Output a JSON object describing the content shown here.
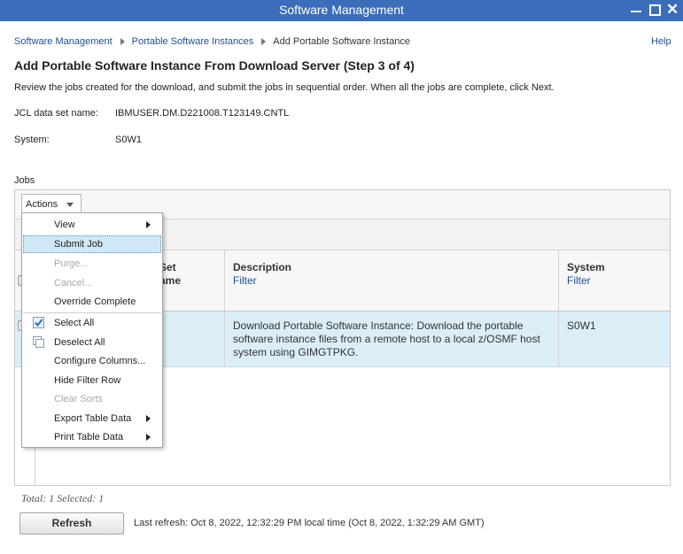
{
  "window": {
    "title": "Software Management"
  },
  "breadcrumb": {
    "items": [
      "Software Management",
      "Portable Software Instances"
    ],
    "current": "Add Portable Software Instance"
  },
  "help_label": "Help",
  "page_title": "Add Portable Software Instance From Download Server (Step 3 of 4)",
  "intro_text": "Review the jobs created for the download, and submit the jobs in sequential order. When all the jobs are complete, click Next.",
  "fields": {
    "jcl": {
      "label": "JCL data set name:",
      "value": "IBMUSER.DM.D221008.T123149.CNTL"
    },
    "system": {
      "label": "System:",
      "value": "S0W1"
    }
  },
  "jobs": {
    "section_label": "Jobs",
    "actions_label": "Actions",
    "columns": {
      "data_set_name_partial": [
        "Set",
        "ame"
      ],
      "description": "Description",
      "system": "System",
      "filter_label": "Filter"
    },
    "rows": [
      {
        "description": "Download Portable Software Instance:  Download the portable software instance files from a remote host to a local z/OSMF host system using GIMGTPKG.",
        "system": "S0W1"
      }
    ],
    "summary": "Total: 1 Selected: 1"
  },
  "actions_menu": {
    "items": [
      {
        "label": "View",
        "submenu": true
      },
      {
        "label": "Submit Job",
        "highlighted": true
      },
      {
        "label": "Purge...",
        "disabled": true
      },
      {
        "label": "Cancel...",
        "disabled": true
      },
      {
        "label": "Override Complete"
      },
      {
        "label": "Select All",
        "icon": "select-all-icon"
      },
      {
        "label": "Deselect All",
        "icon": "deselect-all-icon"
      },
      {
        "label": "Configure Columns..."
      },
      {
        "label": "Hide Filter Row"
      },
      {
        "label": "Clear Sorts",
        "disabled": true
      },
      {
        "label": "Export Table Data",
        "submenu": true
      },
      {
        "label": "Print Table Data",
        "submenu": true
      }
    ]
  },
  "footer": {
    "refresh_label": "Refresh",
    "last_refresh": "Last refresh: Oct 8, 2022, 12:32:29 PM local time (Oct 8, 2022, 1:32:29 AM GMT)"
  },
  "colors": {
    "titlebar": "#3c6dbb",
    "link": "#1d4f91",
    "row_selected": "#dbeef7",
    "menu_highlight": "#cfe8f6"
  }
}
